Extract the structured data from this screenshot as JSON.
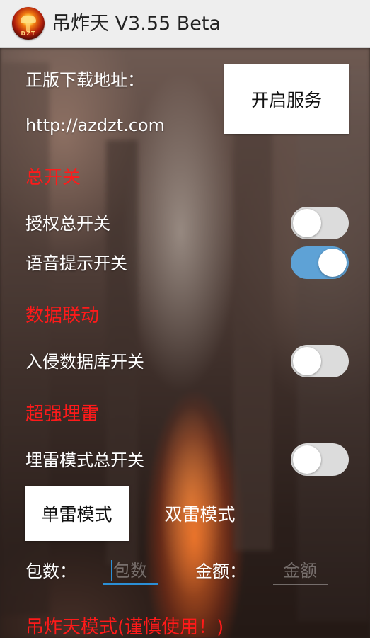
{
  "app": {
    "title": "吊炸天 V3.55 Beta",
    "icon_text": "DZT"
  },
  "download": {
    "label": "正版下载地址：",
    "url": "http://azdzt.com",
    "start_service_label": "开启服务"
  },
  "sections": {
    "master": {
      "title": "总开关",
      "auth_label": "授权总开关",
      "auth_on": false,
      "voice_label": "语音提示开关",
      "voice_on": true
    },
    "data_link": {
      "title": "数据联动",
      "intrude_label": "入侵数据库开关",
      "intrude_on": false
    },
    "mine": {
      "title": "超强埋雷",
      "mine_label": "埋雷模式总开关",
      "mine_on": false,
      "single_mode_label": "单雷模式",
      "double_mode_label": "双雷模式",
      "packets_label": "包数：",
      "packets_placeholder": "包数",
      "amount_label": "金额：",
      "amount_placeholder": "金额"
    },
    "bomb": {
      "title": "吊炸天模式(谨慎使用！)"
    }
  },
  "colors": {
    "section_title": "#ff1a1a",
    "switch_on": "#5ea2d6",
    "switch_off": "#dcdcdc",
    "focus_underline": "#2b8fd6"
  },
  "icons": {
    "app_icon": "explosion-logo-icon"
  }
}
